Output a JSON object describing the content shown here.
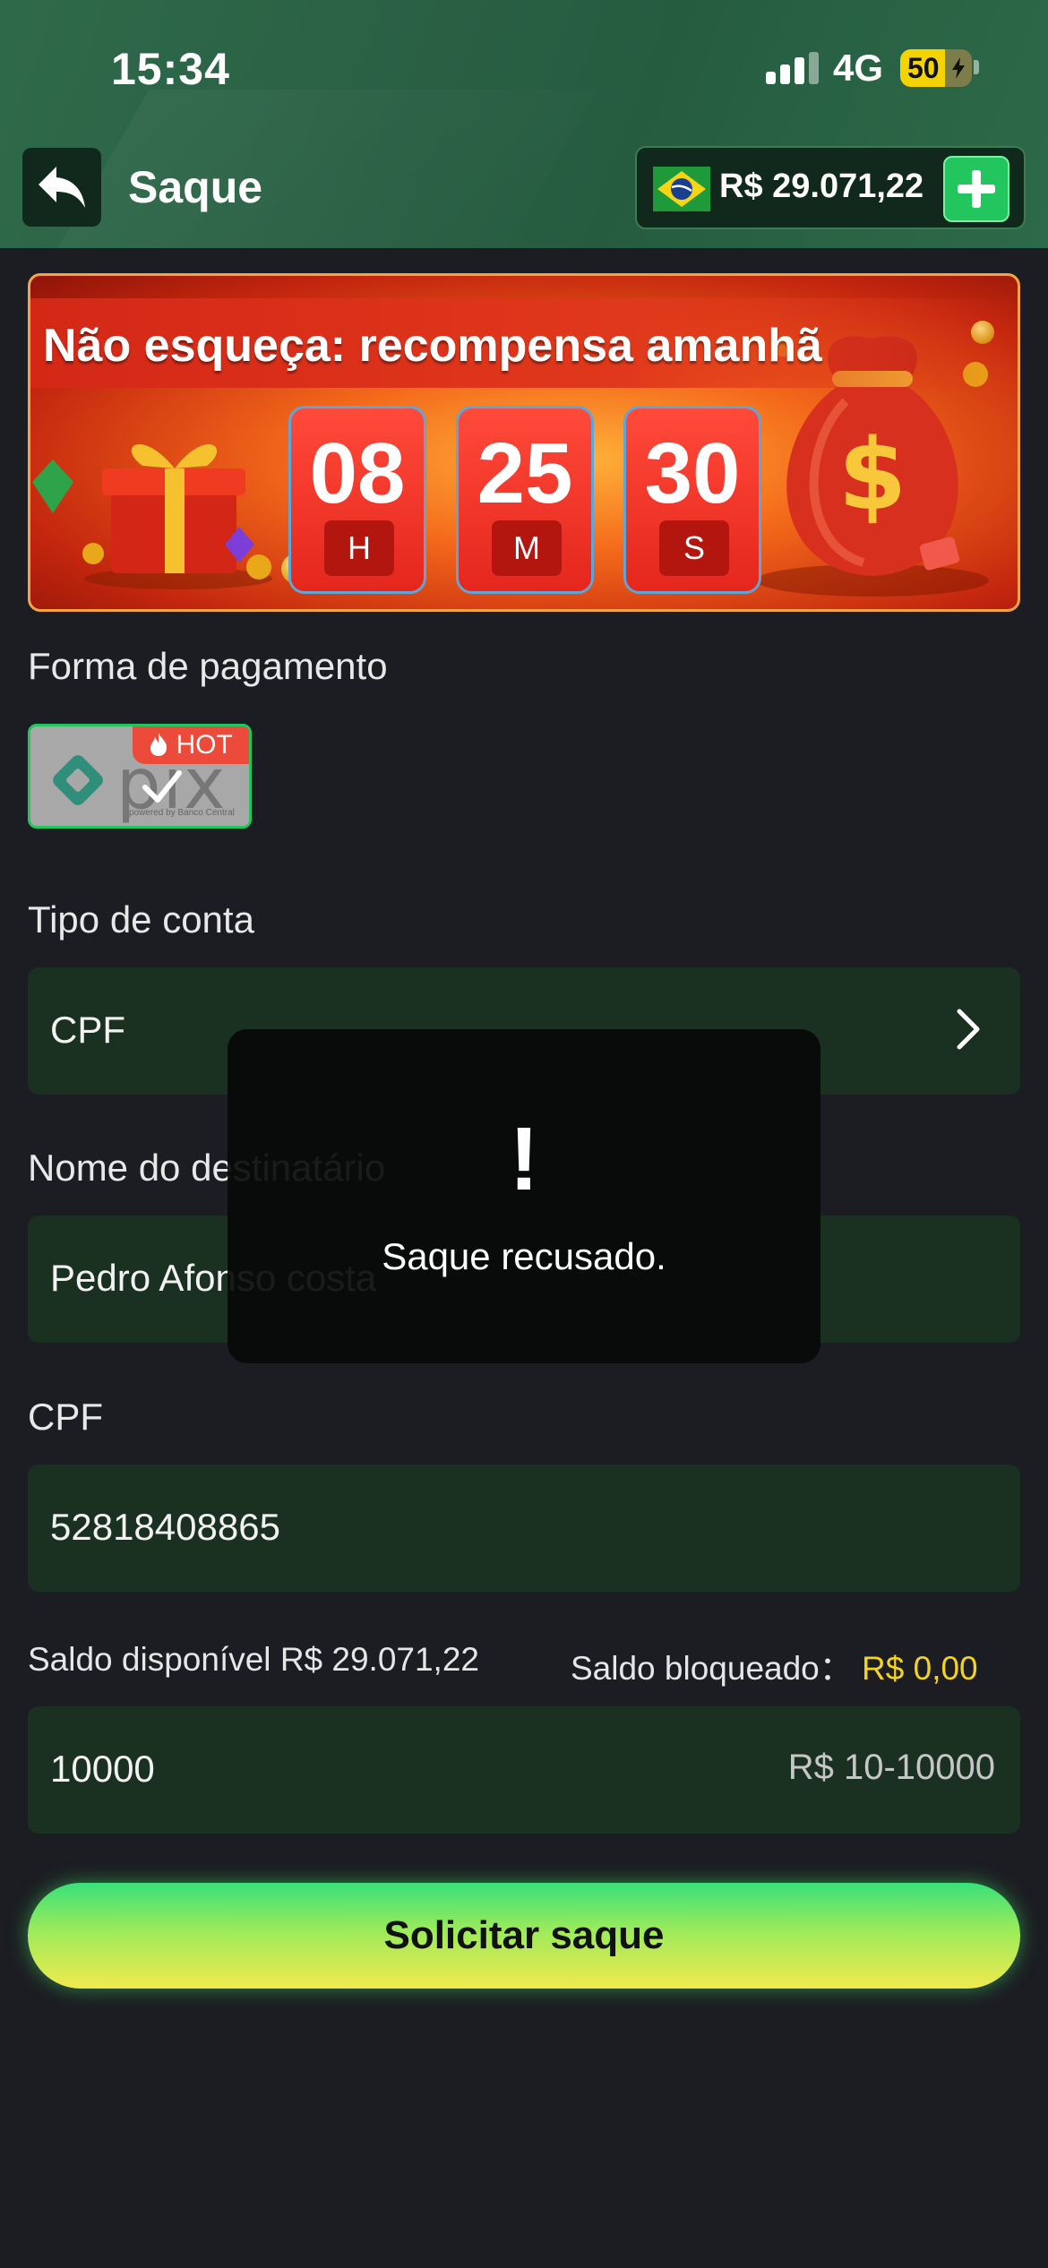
{
  "status_bar": {
    "time": "15:34",
    "network": "4G",
    "battery": "50",
    "battery_level": 0.5
  },
  "header": {
    "title": "Saque",
    "balance": "R$ 29.071,22",
    "flag_icon": "brazil-flag-icon",
    "back_icon": "back-arrow-icon",
    "add_icon": "plus-icon"
  },
  "banner": {
    "title": "Não esqueça: recompensa amanhã",
    "timer": [
      {
        "value": "08",
        "unit": "H"
      },
      {
        "value": "25",
        "unit": "M"
      },
      {
        "value": "30",
        "unit": "S"
      }
    ]
  },
  "payment": {
    "label": "Forma de pagamento",
    "method_badge": "HOT",
    "method_name": "pix",
    "method_tagline": "powered by Banco Central"
  },
  "account_type": {
    "label": "Tipo de conta",
    "value": "CPF"
  },
  "recipient": {
    "label": "Nome do destinatário",
    "value": "Pedro Afonso costa"
  },
  "cpf": {
    "label": "CPF",
    "value": "52818408865"
  },
  "saldo": {
    "available_label": "Saldo disponível",
    "available_value": "R$ 29.071,22",
    "blocked_label": "Saldo bloqueado：",
    "blocked_value": "R$ 0,00"
  },
  "amount": {
    "value": "10000",
    "range": "R$ 10-10000"
  },
  "submit_label": "Solicitar saque",
  "toast": {
    "icon": "!",
    "message": "Saque recusado."
  },
  "colors": {
    "header_bg": "#2a5f44",
    "field_bg": "#1a3020",
    "accent_green": "#22c55e",
    "highlight_yellow": "#f3d31f",
    "page_bg": "#1c1d22"
  }
}
